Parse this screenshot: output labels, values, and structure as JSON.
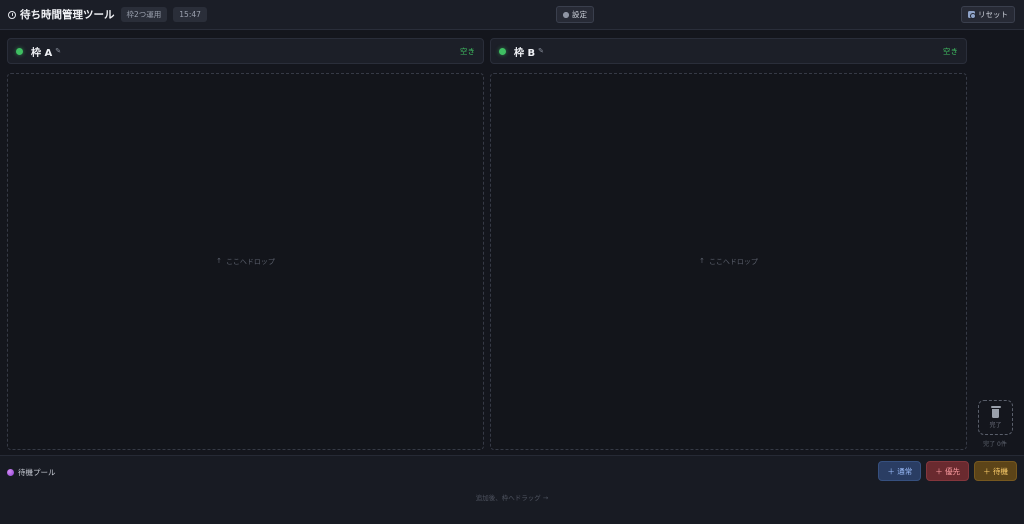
{
  "header": {
    "title": "待ち時間管理ツール",
    "mode_chip": "枠2つ運用",
    "time": "15:47",
    "settings_label": "設定",
    "reset_label": "リセット"
  },
  "slots": [
    {
      "name": "枠 A",
      "edit_glyph": "✎",
      "status": "空き",
      "drop_hint_arrow": "↑",
      "drop_hint": "ここへドロップ"
    },
    {
      "name": "枠 B",
      "edit_glyph": "✎",
      "status": "空き",
      "drop_hint_arrow": "↑",
      "drop_hint": "ここへドロップ"
    }
  ],
  "trash": {
    "label": "完了",
    "count_text": "完了 0件"
  },
  "pool": {
    "title": "待機プール",
    "hint": "追加後、枠へドラッグ →",
    "buttons": {
      "normal": "＋ 通常",
      "priority": "＋ 優先",
      "waiting": "＋ 待機"
    }
  },
  "colors": {
    "free_status": "#3fbf62",
    "normal_btn": "#2a3d63",
    "priority_btn": "#6a2a2f",
    "waiting_btn": "#5c4418"
  },
  "icons": [
    "clock-icon",
    "gear-icon",
    "reset-icon",
    "status-dot",
    "edit-icon",
    "trash-icon",
    "pool-icon"
  ]
}
